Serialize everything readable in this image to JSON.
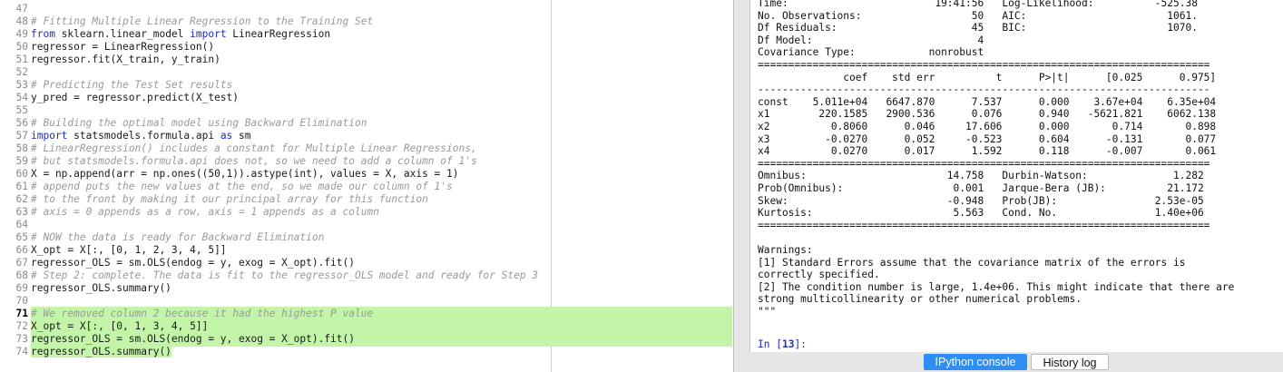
{
  "editor": {
    "lines": [
      {
        "n": "47",
        "t": ""
      },
      {
        "n": "48",
        "t": "# Fitting Multiple Linear Regression to the Training Set"
      },
      {
        "n": "49",
        "t": "from sklearn.linear_model import LinearRegression"
      },
      {
        "n": "50",
        "t": "regressor = LinearRegression()"
      },
      {
        "n": "51",
        "t": "regressor.fit(X_train, y_train)"
      },
      {
        "n": "52",
        "t": ""
      },
      {
        "n": "53",
        "t": "# Predicting the Test Set results"
      },
      {
        "n": "54",
        "t": "y_pred = regressor.predict(X_test)"
      },
      {
        "n": "55",
        "t": ""
      },
      {
        "n": "56",
        "t": "# Building the optimal model using Backward Elimination"
      },
      {
        "n": "57",
        "t": "import statsmodels.formula.api as sm"
      },
      {
        "n": "58",
        "t": "# LinearRegression() includes a constant for Multiple Linear Regressions,"
      },
      {
        "n": "59",
        "t": "# but statsmodels.formula.api does not, so we need to add a column of 1's"
      },
      {
        "n": "60",
        "t": "X = np.append(arr = np.ones((50,1)).astype(int), values = X, axis = 1)"
      },
      {
        "n": "61",
        "t": "# append puts the new values at the end, so we made our column of 1's"
      },
      {
        "n": "62",
        "t": "# to the front by making it our principal array for this function"
      },
      {
        "n": "63",
        "t": "# axis = 0 appends as a row, axis = 1 appends as a column"
      },
      {
        "n": "64",
        "t": ""
      },
      {
        "n": "65",
        "t": "# NOW the data is ready for Backward Elimination"
      },
      {
        "n": "66",
        "t": "X_opt = X[:, [0, 1, 2, 3, 4, 5]]"
      },
      {
        "n": "67",
        "t": "regressor_OLS = sm.OLS(endog = y, exog = X_opt).fit()"
      },
      {
        "n": "68",
        "t": "# Step 2: complete. The data is fit to the regressor_OLS model and ready for Step 3"
      },
      {
        "n": "69",
        "t": "regressor_OLS.summary()"
      },
      {
        "n": "70",
        "t": ""
      },
      {
        "n": "71",
        "t": "# We removed column 2 because it had the highest P value"
      },
      {
        "n": "72",
        "t": "X_opt = X[:, [0, 1, 3, 4, 5]]"
      },
      {
        "n": "73",
        "t": "regressor_OLS = sm.OLS(endog = y, exog = X_opt).fit()"
      },
      {
        "n": "74",
        "t": "regressor_OLS.summary()"
      }
    ]
  },
  "console": {
    "lines": [
      "Time:                        19:41:56   Log-Likelihood:          -525.38",
      "No. Observations:                  50   AIC:                       1061.",
      "Df Residuals:                      45   BIC:                       1070.",
      "Df Model:                           4",
      "Covariance Type:            nonrobust",
      "==========================================================================",
      "              coef    std err          t      P>|t|      [0.025      0.975]",
      "--------------------------------------------------------------------------",
      "const    5.011e+04   6647.870      7.537      0.000    3.67e+04    6.35e+04",
      "x1        220.1585   2900.536      0.076      0.940   -5621.821    6062.138",
      "x2          0.8060      0.046     17.606      0.000       0.714       0.898",
      "x3         -0.0270      0.052     -0.523      0.604      -0.131       0.077",
      "x4          0.0270      0.017      1.592      0.118      -0.007       0.061",
      "==========================================================================",
      "Omnibus:                       14.758   Durbin-Watson:              1.282",
      "Prob(Omnibus):                  0.001   Jarque-Bera (JB):          21.172",
      "Skew:                          -0.948   Prob(JB):                2.53e-05",
      "Kurtosis:                       5.563   Cond. No.                1.40e+06",
      "==========================================================================",
      "",
      "Warnings:",
      "[1] Standard Errors assume that the covariance matrix of the errors is",
      "correctly specified.",
      "[2] The condition number is large, 1.4e+06. This might indicate that there are",
      "strong multicollinearity or other numerical problems.",
      "\"\"\"",
      "",
      ""
    ],
    "prompt_prefix": "In [",
    "prompt_num": "13",
    "prompt_suffix": "]:"
  },
  "tabs": {
    "ipython": "IPython console",
    "history": "History log"
  }
}
